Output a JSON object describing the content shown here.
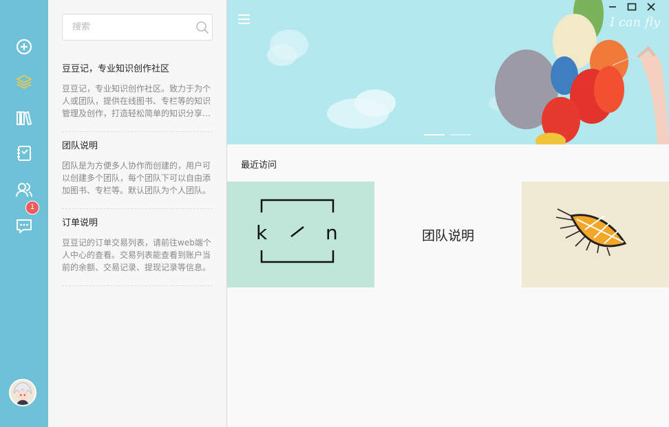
{
  "sidebar": {
    "icons": [
      "add-circle-icon",
      "layers-icon",
      "books-icon",
      "notebook-icon",
      "team-icon",
      "message-icon"
    ],
    "active_icon": "layers-icon",
    "badge_count": "1",
    "accent": "#6ec1d6",
    "active_color": "#f2c94c"
  },
  "search": {
    "placeholder": "搜索"
  },
  "documents": [
    {
      "title": "豆豆记，专业知识创作社区",
      "desc": "豆豆记，专业知识创作社区。致力于为个人或团队，提供在线图书、专栏等的知识管理及创作，打造轻松简单的知识分享平台。"
    },
    {
      "title": "团队说明",
      "desc": "团队是为方便多人协作而创建的，用户可以创建多个团队，每个团队下可以自由添加图书、专栏等。默认团队为个人团队。"
    },
    {
      "title": "订单说明",
      "desc": "豆豆记的订单交易列表，请前往web端个人中心的查看。交易列表能查看到账户当前的余额、交易记录、提现记录等信息。"
    }
  ],
  "banner": {
    "caption": "I can fly",
    "slides": 2,
    "active_slide": 1
  },
  "recent": {
    "title": "最近访问",
    "cards": [
      {
        "type": "logo",
        "letters": [
          "k",
          "n"
        ]
      },
      {
        "type": "text",
        "label": "团队说明"
      },
      {
        "type": "image"
      }
    ]
  }
}
